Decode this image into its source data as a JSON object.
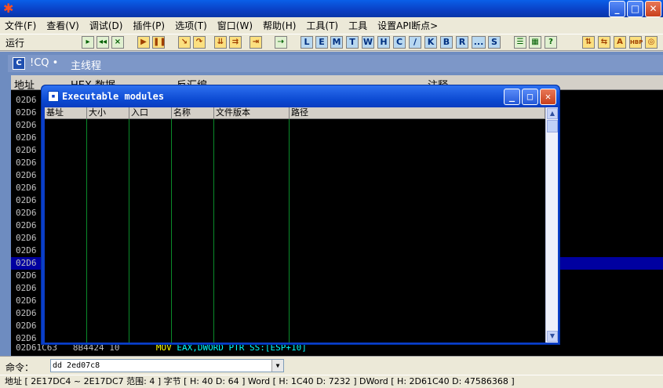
{
  "window": {
    "minimize": "_",
    "maximize": "□",
    "close": "✕"
  },
  "menu": [
    "文件(F)",
    "查看(V)",
    "调试(D)",
    "插件(P)",
    "选项(T)",
    "窗口(W)",
    "帮助(H)",
    "工具(T)",
    "工具",
    "设置API断点>"
  ],
  "toolbar": {
    "status": "运行",
    "letters": [
      "L",
      "E",
      "M",
      "T",
      "W",
      "H",
      "C",
      "/",
      "K",
      "B",
      "R",
      "...",
      "S"
    ]
  },
  "cpu_window": {
    "module": "!CQ",
    "bullet": "•",
    "thread": "主线程",
    "columns": [
      "地址",
      "HEX 数据",
      "反汇编",
      "注释"
    ],
    "address_rows": [
      "02D6",
      "02D6",
      "02D6",
      "02D6",
      "02D6",
      "02D6",
      "02D6",
      "02D6",
      "02D6",
      "02D6",
      "02D6",
      "02D6",
      "02D6",
      "02D6",
      "02D6",
      "02D6",
      "02D6",
      "02D6",
      "02D6",
      "02D6"
    ],
    "last_row": {
      "address": "02D61C63",
      "hex": "8B4424 10",
      "op": "MOV",
      "args": "EAX,DWORD PTR SS:[ESP+10]"
    }
  },
  "modules_dialog": {
    "title": "Executable modules",
    "columns": [
      "基址",
      "大小",
      "入口",
      "名称",
      "文件版本",
      "路径"
    ]
  },
  "command": {
    "label": "命令：",
    "value": "dd 2ed07c8"
  },
  "status_bar": "地址 [ 2E17DC4 ~ 2E17DC7 范围: 4 ] 字节 [ H: 40 D: 64 ] Word [ H: 1C40 D: 7232 ] DWord [ H: 2D61C40 D: 47586368 ]",
  "colors": {
    "title_blue": "#0a48d0",
    "selected_row": "#0000a0",
    "mnemonic": "#ffff00",
    "register": "#00ffff",
    "column_line": "#0a8a2a"
  }
}
